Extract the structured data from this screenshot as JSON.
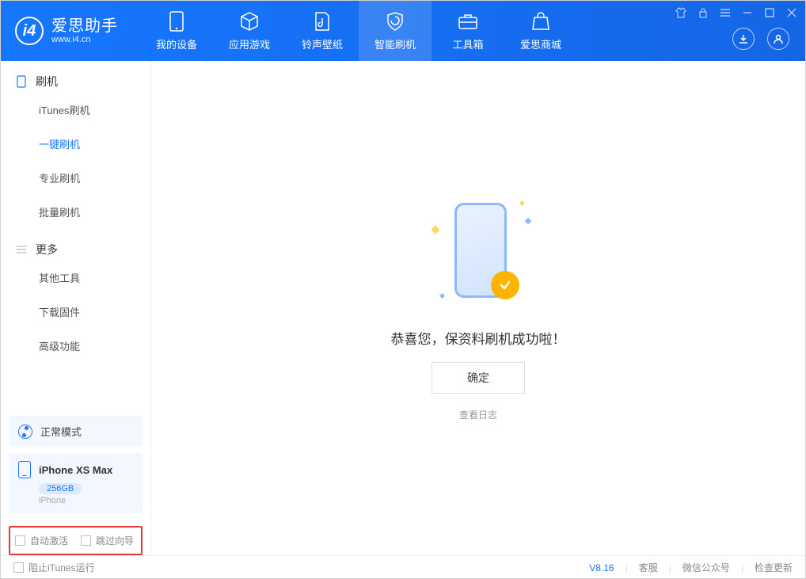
{
  "app": {
    "title": "爱思助手",
    "subtitle": "www.i4.cn"
  },
  "nav": {
    "items": [
      {
        "label": "我的设备"
      },
      {
        "label": "应用游戏"
      },
      {
        "label": "铃声壁纸"
      },
      {
        "label": "智能刷机"
      },
      {
        "label": "工具箱"
      },
      {
        "label": "爱思商城"
      }
    ]
  },
  "sidebar": {
    "section1": {
      "title": "刷机"
    },
    "items1": [
      {
        "label": "iTunes刷机"
      },
      {
        "label": "一键刷机"
      },
      {
        "label": "专业刷机"
      },
      {
        "label": "批量刷机"
      }
    ],
    "section2": {
      "title": "更多"
    },
    "items2": [
      {
        "label": "其他工具"
      },
      {
        "label": "下载固件"
      },
      {
        "label": "高级功能"
      }
    ]
  },
  "mode": {
    "label": "正常模式"
  },
  "device": {
    "name": "iPhone XS Max",
    "storage": "256GB",
    "subtype": "iPhone"
  },
  "options": {
    "auto_activate": "自动激活",
    "skip_wizard": "跳过向导"
  },
  "main": {
    "success_text": "恭喜您，保资料刷机成功啦！",
    "ok_label": "确定",
    "log_link": "查看日志"
  },
  "footer": {
    "block_itunes": "阻止iTunes运行",
    "version": "V8.16",
    "links": {
      "service": "客服",
      "wechat": "微信公众号",
      "update": "检查更新"
    }
  }
}
